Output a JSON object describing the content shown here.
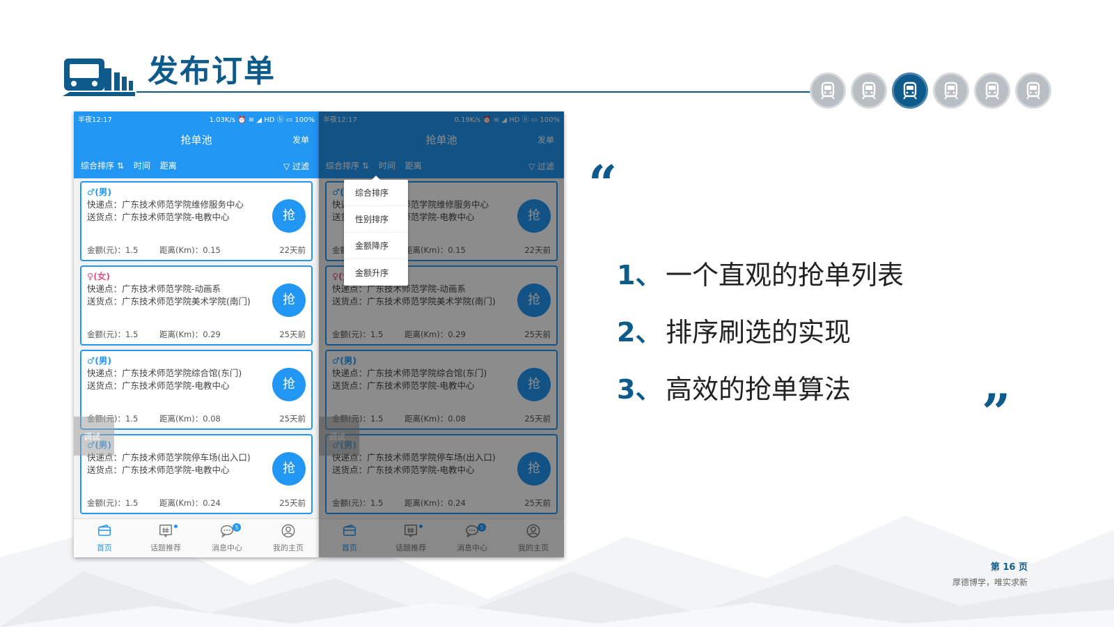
{
  "slide": {
    "title": "发布订单",
    "points": [
      {
        "num": "1、",
        "text": "一个直观的抢单列表"
      },
      {
        "num": "2、",
        "text": "排序刷选的实现"
      },
      {
        "num": "3、",
        "text": "高效的抢单算法"
      }
    ],
    "quote_open": "“",
    "quote_close": "”",
    "page_label": "第 16 页",
    "motto": "厚德博学，唯实求新",
    "nav_active_index": 2,
    "nav_count": 6,
    "colors": {
      "brand": "#0e5a8a",
      "app_blue": "#2196f3"
    }
  },
  "left_phone": {
    "status_left": "半夜12:17",
    "status_right": "1.03K/s ⏰ ≋ ◢ HD ⓑ ▭ 100%",
    "title": "抢单池",
    "publish": "发单",
    "sort": [
      "综合排序 ⇅",
      "时间",
      "距离"
    ],
    "filter": "▽ 过滤",
    "debug": "调试",
    "cards": [
      {
        "gender": "♂(男)",
        "female": false,
        "line1": "快递点：广东技术师范学院维修服务中心",
        "line2": "送货点：广东技术师范学院-电教中心",
        "money": "金额(元)：1.5",
        "dist": "距离(Km)：0.15",
        "age": "22天前",
        "btn": "抢"
      },
      {
        "gender": "♀(女)",
        "female": true,
        "line1": "快递点：广东技术师范学院-动画系",
        "line2": "送货点：广东技术师范学院美术学院(南门)",
        "money": "金额(元)：1.5",
        "dist": "距离(Km)：0.29",
        "age": "25天前",
        "btn": "抢"
      },
      {
        "gender": "♂(男)",
        "female": false,
        "line1": "快递点：广东技术师范学院综合馆(东门)",
        "line2": "送货点：广东技术师范学院-电教中心",
        "money": "金额(元)：1.5",
        "dist": "距离(Km)：0.08",
        "age": "25天前",
        "btn": "抢"
      },
      {
        "gender": "♂(男)",
        "female": false,
        "line1": "快递点：广东技术师范学院停车场(出入口)",
        "line2": "送货点：广东技术师范学院-电教中心",
        "money": "金额(元)：1.5",
        "dist": "距离(Km)：0.24",
        "age": "25天前",
        "btn": "抢"
      }
    ],
    "tabs": [
      {
        "label": "首页",
        "icon": "wallet-icon",
        "active": true
      },
      {
        "label": "话题推荐",
        "icon": "topic-icon",
        "active": false
      },
      {
        "label": "消息中心",
        "icon": "message-icon",
        "active": false,
        "badge": "5"
      },
      {
        "label": "我的主页",
        "icon": "profile-icon",
        "active": false
      }
    ]
  },
  "right_phone": {
    "status_left": "半夜12:17",
    "status_right": "0.19K/s ⏰ ≋ ◢ HD ⓑ ▭ 100%",
    "sort_menu": [
      "综合排序",
      "性别排序",
      "金额降序",
      "金额升序"
    ]
  }
}
